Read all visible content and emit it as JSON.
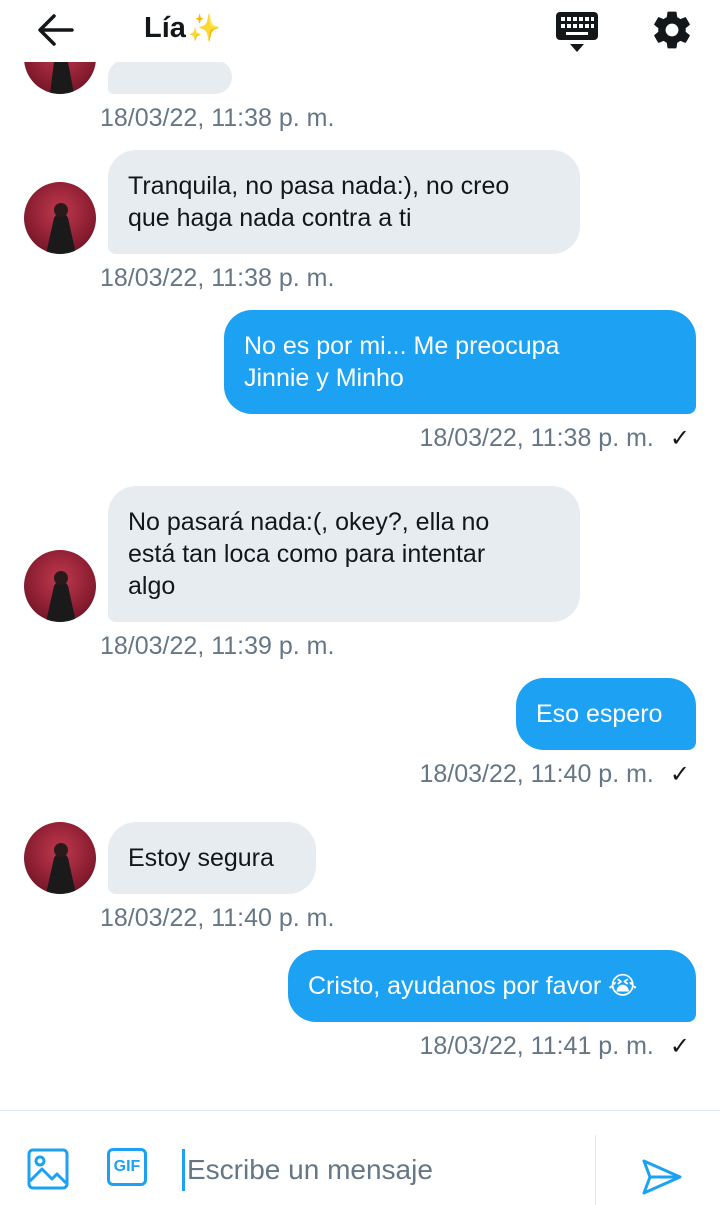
{
  "header": {
    "title": "Lía",
    "title_emoji": "✨"
  },
  "messages": [
    {
      "direction": "in",
      "text": "",
      "timestamp": "18/03/22, 11:38 p. m."
    },
    {
      "direction": "in",
      "text": "Tranquila, no pasa nada:), no creo\nque haga nada contra a ti",
      "timestamp": "18/03/22, 11:38 p. m."
    },
    {
      "direction": "out",
      "text": "No es por mi... Me preocupa\nJinnie y Minho",
      "timestamp": "18/03/22, 11:38 p. m.",
      "check": "✓"
    },
    {
      "direction": "in",
      "text": "No pasará nada:(, okey?, ella no\nestá tan loca como para intentar\nalgo",
      "timestamp": "18/03/22, 11:39 p. m."
    },
    {
      "direction": "out",
      "text": "Eso espero",
      "timestamp": "18/03/22, 11:40 p. m.",
      "check": "✓"
    },
    {
      "direction": "in",
      "text": "Estoy segura",
      "timestamp": "18/03/22, 11:40 p. m."
    },
    {
      "direction": "out",
      "text": "Cristo, ayudanos por favor 😭",
      "timestamp": "18/03/22, 11:41 p. m.",
      "check": "✓"
    }
  ],
  "composer": {
    "gif_label": "GIF",
    "placeholder": "Escribe un mensaje"
  },
  "colors": {
    "accent": "#1da1f2",
    "incoming_bubble": "#e6ecf0",
    "timestamp": "#657786"
  },
  "icons": [
    "back-arrow-icon",
    "keyboard-icon",
    "gear-icon",
    "image-icon",
    "gif-icon",
    "send-icon",
    "check-icon"
  ]
}
